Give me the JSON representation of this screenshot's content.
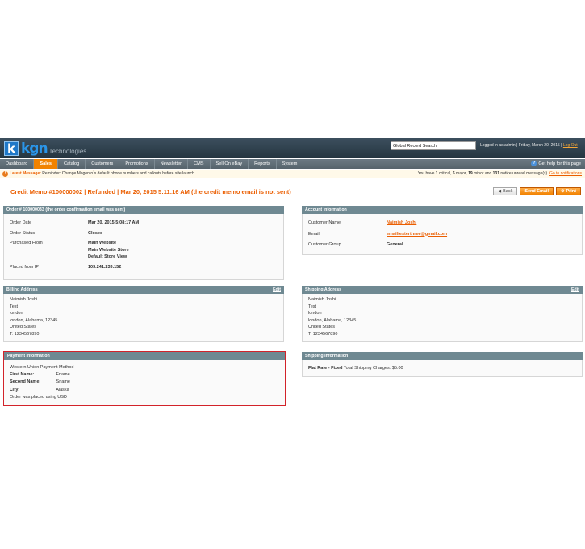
{
  "header": {
    "logo_k": "k",
    "logo_kgn": "kgn",
    "logo_tagline": "Technologies",
    "search_value": "Global Record Search",
    "logged_in_text": "Logged in as admin | Friday, March 20, 2015 |",
    "logout_label": "Log Out"
  },
  "nav": {
    "items": [
      "Dashboard",
      "Sales",
      "Catalog",
      "Customers",
      "Promotions",
      "Newsletter",
      "CMS",
      "Sell On eBay",
      "Reports",
      "System"
    ],
    "active": "Sales",
    "help_label": "Get help for this page"
  },
  "notice": {
    "label": "Latest Message:",
    "text": "Reminder: Change Magento`s default phone numbers and callouts before site launch",
    "summary_prefix": "You have",
    "critical_count": "1",
    "critical_label": "critical,",
    "major_count": "6",
    "major_label": "major,",
    "minor_count": "19",
    "minor_label": "minor and",
    "notice_count": "131",
    "notice_label": "notice unread message(s).",
    "goto_label": "Go to notifications"
  },
  "page": {
    "title": "Credit Memo #100000002 | Refunded | Mar 20, 2015 5:11:16 AM (the credit memo email is not sent)",
    "back_label": "Back",
    "send_email_label": "Send Email",
    "print_label": "Print"
  },
  "order_box": {
    "order_link": "Order # 100000033",
    "order_note": "(the order confirmation email was sent)",
    "order_date_label": "Order Date",
    "order_date": "Mar 20, 2015 5:08:17 AM",
    "order_status_label": "Order Status",
    "order_status": "Closed",
    "purchased_from_label": "Purchased From",
    "purchased_from": [
      "Main Website",
      "Main Website Store",
      "Default Store View"
    ],
    "placed_ip_label": "Placed from IP",
    "placed_ip": "103.241.233.152"
  },
  "account_box": {
    "title": "Account Information",
    "customer_name_label": "Customer Name",
    "customer_name": "Naimish Joshi",
    "email_label": "Email",
    "email": "emailtesterthree@gmail.com",
    "group_label": "Customer Group",
    "group": "General"
  },
  "billing_box": {
    "title": "Billing Address",
    "edit_label": "Edit",
    "lines": [
      "Naimish Joshi",
      "Test",
      "london",
      "london, Alabama, 12345",
      "United States",
      "T: 1234567890"
    ]
  },
  "shipping_box": {
    "title": "Shipping Address",
    "edit_label": "Edit",
    "lines": [
      "Naimish Joshi",
      "Test",
      "london",
      "london, Alabama, 12345",
      "United States",
      "T: 1234567890"
    ]
  },
  "payment_box": {
    "title": "Payment Information",
    "method": "Western Union Payment Method",
    "first_name_label": "First Name:",
    "first_name": "Fname",
    "second_name_label": "Second Name:",
    "second_name": "Sname",
    "city_label": "City:",
    "city": "Alaska",
    "currency_note": "Order was placed using USD"
  },
  "shipping_info_box": {
    "title": "Shipping Information",
    "rate_label": "Flat Rate - Fixed",
    "charges_text": "Total Shipping Charges: $5.00"
  }
}
